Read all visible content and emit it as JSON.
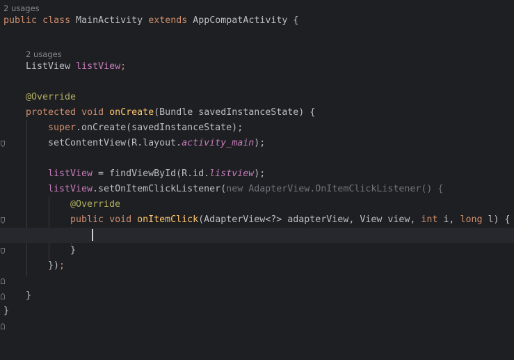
{
  "editor": {
    "hints": {
      "class_usages": "2 usages",
      "field_usages": "2 usages"
    },
    "class_decl": {
      "kw1": "public",
      "kw2": "class",
      "name": "MainActivity",
      "kw3": "extends",
      "parent": "AppCompatActivity",
      "brace": " {"
    },
    "field_decl": {
      "type": "ListView",
      "name": "listView",
      "semi": ";"
    },
    "override1": "@Override",
    "method_decl": {
      "kw1": "protected",
      "kw2": "void",
      "name": "onCreate",
      "params": "(Bundle savedInstanceState) {"
    },
    "super_call": {
      "kw": "super",
      "rest": ".onCreate(savedInstanceState);"
    },
    "set_content": {
      "pre": "setContentView(R.layout.",
      "ref": "activity_main",
      "post": ");"
    },
    "find_view": {
      "field": "listView",
      "mid": " = findViewById(R.id.",
      "ref": "listview",
      "post": ");"
    },
    "listener": {
      "field": "listView",
      "call": ".setOnItemClickListener(",
      "kw_new": "new",
      "anon": " AdapterView.OnItemClickListener() {"
    },
    "override2": "@Override",
    "item_click": {
      "kw1": "public",
      "kw2": "void",
      "name": "onItemClick",
      "p1": "(AdapterView<?> adapterView, View view, ",
      "kw_int": "int",
      "p2": " i, ",
      "kw_long": "long",
      "p3": " l) {"
    },
    "close_inner": "}",
    "close_listener_a": "})",
    "close_listener_b": ";",
    "close_method": "}",
    "close_class": "}"
  }
}
